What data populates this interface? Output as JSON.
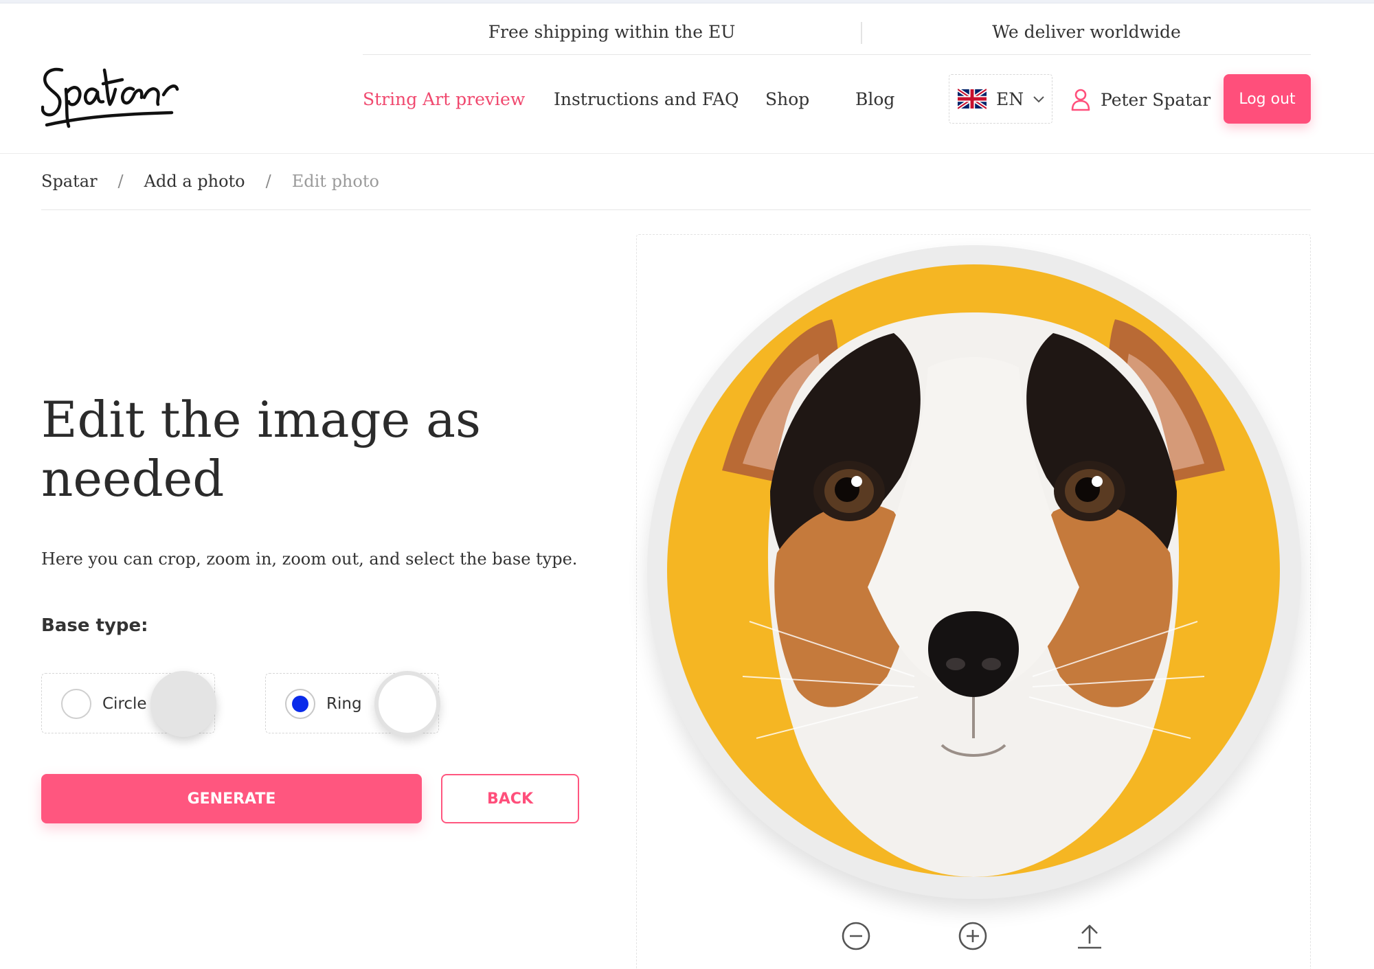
{
  "header": {
    "logo_text": "Spatar",
    "promo_left": "Free shipping within the EU",
    "promo_right": "We deliver worldwide",
    "nav": [
      {
        "label": "String Art preview",
        "active": true
      },
      {
        "label": "Instructions and FAQ",
        "active": false
      },
      {
        "label": "Shop",
        "active": false
      },
      {
        "label": "Blog",
        "active": false
      }
    ],
    "language": {
      "code": "EN",
      "flag_icon": "uk-flag-icon"
    },
    "user_name": "Peter Spatar",
    "logout_label": "Log out"
  },
  "breadcrumb": {
    "items": [
      "Spatar",
      "Add a photo",
      "Edit photo"
    ],
    "separator": "/"
  },
  "main": {
    "title": "Edit the image as needed",
    "description": "Here you can crop, zoom in, zoom out, and select the base type.",
    "base_type_label": "Base type:",
    "base_options": [
      {
        "label": "Circle",
        "selected": false
      },
      {
        "label": "Ring",
        "selected": true
      }
    ],
    "generate_label": "GENERATE",
    "back_label": "BACK"
  },
  "editor": {
    "image_subject": "dog portrait on yellow background",
    "tools": [
      "zoom-out-icon",
      "zoom-in-icon",
      "upload-icon"
    ]
  },
  "colors": {
    "accent": "#ff567f",
    "nav_active": "#f0486e",
    "radio_selected": "#0a2bea",
    "photo_background": "#f5b623"
  }
}
